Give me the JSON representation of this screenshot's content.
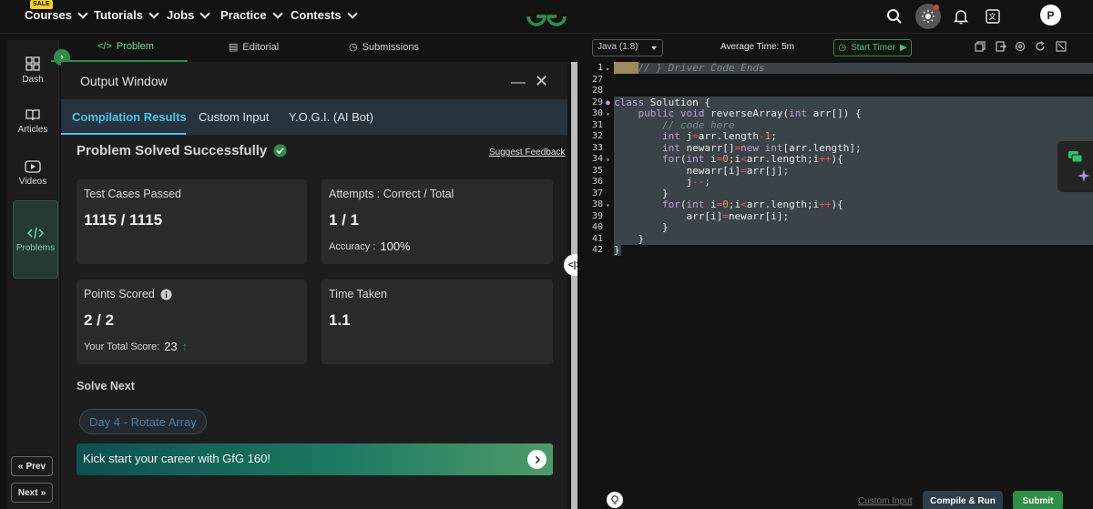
{
  "nav": {
    "sale_badge": "SALE",
    "items": [
      "Courses",
      "Tutorials",
      "Jobs",
      "Practice",
      "Contests"
    ],
    "avatar_initial": "P"
  },
  "rail": {
    "items": [
      {
        "label": "Dash",
        "icon": "dashboard-icon"
      },
      {
        "label": "Articles",
        "icon": "book-icon"
      },
      {
        "label": "Videos",
        "icon": "video-icon"
      },
      {
        "label": "Problems",
        "icon": "code-icon"
      }
    ],
    "prev": "Prev",
    "next": "Next"
  },
  "problem_tabs": [
    "Problem",
    "Editorial",
    "Submissions"
  ],
  "output": {
    "title": "Output Window",
    "tabs": [
      "Compilation Results",
      "Custom Input",
      "Y.O.G.I. (AI Bot)"
    ],
    "status": "Problem Solved Successfully",
    "feedback": "Suggest Feedback",
    "cards": {
      "test_cases": {
        "label": "Test Cases Passed",
        "value": "1115 / 1115"
      },
      "attempts": {
        "label": "Attempts : Correct / Total",
        "value": "1 / 1",
        "sub_label": "Accuracy :",
        "sub_value": "100%"
      },
      "points": {
        "label": "Points Scored",
        "value": "2 / 2",
        "sub_label": "Your Total Score:",
        "sub_value": "23"
      },
      "time": {
        "label": "Time Taken",
        "value": "1.1"
      }
    },
    "solve_next_label": "Solve Next",
    "next_problem": "Day 4 - Rotate Array",
    "banner": "Kick start your career with GfG 160!"
  },
  "editor": {
    "language": "Java (1.8)",
    "avg_time": "Average Time: 5m",
    "start_timer": "Start Timer",
    "custom_input": "Custom Input",
    "compile_run": "Compile & Run",
    "submit": "Submit",
    "line_numbers": [
      "1",
      "27",
      "28",
      "29",
      "30",
      "31",
      "32",
      "33",
      "34",
      "35",
      "36",
      "37",
      "38",
      "39",
      "40",
      "41",
      "42"
    ]
  },
  "colors": {
    "accent_green": "#2f8d46",
    "accent_blue": "#4fc0ea",
    "card_bg": "#2a2a2a"
  }
}
